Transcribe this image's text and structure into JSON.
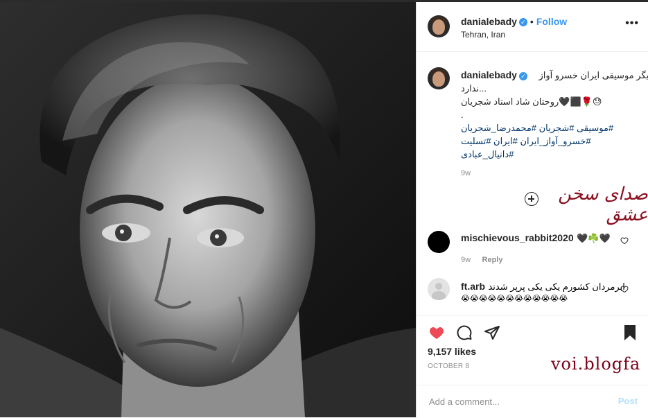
{
  "post": {
    "username": "danialebady",
    "verified_mark": "✓",
    "follow_label": "Follow",
    "location": "Tehran, Iran",
    "more_label": "•••"
  },
  "caption": {
    "username": "danialebady",
    "line1": "دیگر موسیقی ایران خسرو آواز",
    "line2": "...ندارد",
    "line3": "😓🌹⬛🖤روحتان شاد استاد شجریان",
    "line4": ".",
    "line5": "#موسیقی #شجریان #محمدرضا_شجریان",
    "line6": "#خسرو_آواز_ایران #ایران #تسلیت",
    "line7": "#دانیال_عبادی",
    "age": "9w"
  },
  "overlay": {
    "signature": "صدای سخن عشق",
    "watermark": "voi.blogfa"
  },
  "comments": [
    {
      "username": "mischievous_rabbit2020",
      "text": "🖤☘️🖤",
      "age": "9w",
      "reply": "Reply"
    },
    {
      "username": "ft.arb",
      "text": "ابرمردان کشورم یکی یکی پرپر شدند",
      "emoji": "😭😭😭😭😭😭😭😭😭😭😭😭"
    }
  ],
  "likes": "9,157 likes",
  "date": "OCTOBER 8",
  "add_comment": {
    "placeholder": "Add a comment...",
    "post_label": "Post"
  },
  "colors": {
    "accent": "#3897f0",
    "like": "#ed4956",
    "signature": "#8b1020"
  },
  "icons": [
    "heart-icon",
    "comment-icon",
    "share-icon",
    "bookmark-icon",
    "more-icon",
    "verified-icon",
    "add-icon"
  ]
}
